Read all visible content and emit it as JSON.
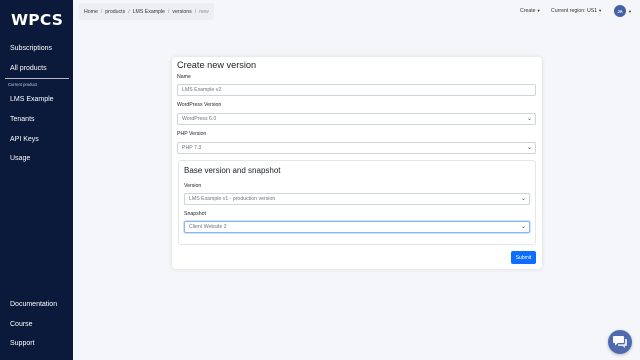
{
  "app": {
    "logo": "WPCS"
  },
  "sidebar": {
    "top_items": [
      {
        "label": "Subscriptions"
      },
      {
        "label": "All products"
      }
    ],
    "current_product_caption": "Current product",
    "product_items": [
      {
        "label": "LMS Example"
      },
      {
        "label": "Tenants"
      },
      {
        "label": "API Keys"
      },
      {
        "label": "Usage"
      }
    ],
    "bottom_items": [
      {
        "label": "Documentation"
      },
      {
        "label": "Course"
      },
      {
        "label": "Support"
      }
    ]
  },
  "breadcrumb": {
    "items": [
      "Home",
      "products",
      "LMS Example",
      "versions",
      "new"
    ],
    "separator": "/"
  },
  "topbar": {
    "create_label": "Create",
    "region_label": "Current region: US1",
    "avatar_initials": "JA"
  },
  "form": {
    "title": "Create new version",
    "name_label": "Name",
    "name_value": "LMS Example v2",
    "wp_version_label": "WordPress Version",
    "wp_version_value": "WordPress 6.0",
    "php_version_label": "PHP Version",
    "php_version_value": "PHP 7.3",
    "base_section_title": "Base version and snapshot",
    "version_label": "Version",
    "version_value": "LMS Example v1 - production version",
    "snapshot_label": "Snapshot",
    "snapshot_value": "Client Website 2",
    "submit_label": "Submit"
  },
  "colors": {
    "sidebar_bg": "#0b1a3a",
    "primary": "#0d6efd",
    "page_bg": "#f5f6f9",
    "avatar_bg": "#4561a6"
  },
  "icons": {
    "select_chevron": "chevron-down-icon",
    "chat": "chat-icon"
  }
}
